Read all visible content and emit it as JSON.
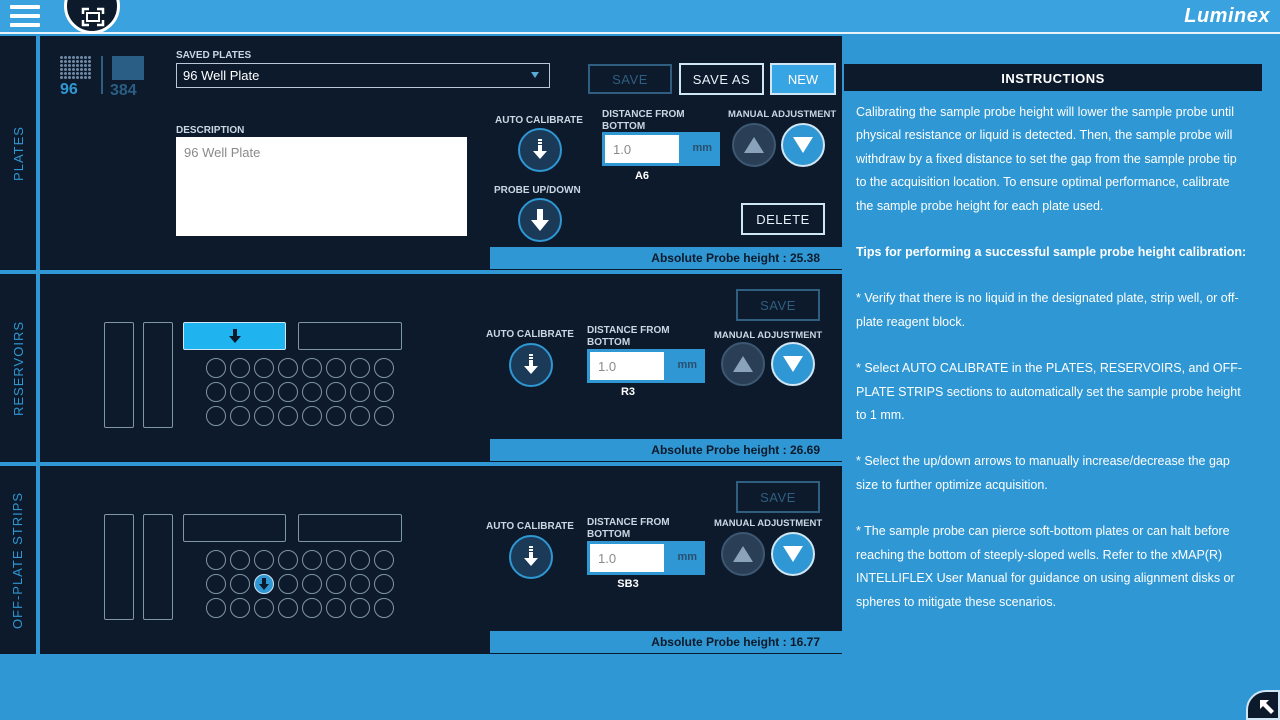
{
  "brand": "Luminex",
  "plates": {
    "tab": "PLATES",
    "thumb_96": "96",
    "thumb_384": "384",
    "saved_label": "SAVED PLATES",
    "saved_value": "96 Well Plate",
    "description_label": "DESCRIPTION",
    "description_value": "96 Well Plate",
    "save": "SAVE",
    "save_as": "SAVE AS",
    "new": "NEW",
    "auto_calibrate": "AUTO CALIBRATE",
    "probe_updown": "PROBE UP/DOWN",
    "distance_label": "DISTANCE FROM BOTTOM",
    "distance_value": "1.0",
    "unit": "mm",
    "well": "A6",
    "manual_adjustment": "MANUAL ADJUSTMENT",
    "delete": "DELETE",
    "abs_height": "Absolute Probe height :  25.38"
  },
  "reservoirs": {
    "tab": "RESERVOIRS",
    "save": "SAVE",
    "auto_calibrate": "AUTO CALIBRATE",
    "distance_label": "DISTANCE FROM BOTTOM",
    "distance_value": "1.0",
    "unit": "mm",
    "well": "R3",
    "manual_adjustment": "MANUAL ADJUSTMENT",
    "abs_height": "Absolute Probe height :  26.69"
  },
  "strips": {
    "tab": "OFF-PLATE STRIPS",
    "save": "SAVE",
    "auto_calibrate": "AUTO CALIBRATE",
    "distance_label": "DISTANCE FROM BOTTOM",
    "distance_value": "1.0",
    "unit": "mm",
    "well": "SB3",
    "manual_adjustment": "MANUAL ADJUSTMENT",
    "abs_height": "Absolute Probe height :  16.77"
  },
  "instructions": {
    "title": "INSTRUCTIONS",
    "p1": "Calibrating the sample probe height will lower the sample probe until physical resistance or liquid is detected. Then, the sample probe will withdraw by a fixed distance to set the gap from the sample probe tip to the acquisition location. To ensure optimal performance, calibrate the sample probe height for each plate used.",
    "tips_title": "Tips for performing a successful sample probe height calibration:",
    "tip1": "* Verify that there is no liquid in the designated plate, strip well, or off-plate reagent block.",
    "tip2": "* Select AUTO CALIBRATE in the PLATES, RESERVOIRS, and OFF-PLATE STRIPS sections to automatically set the sample probe height to 1 mm.",
    "tip3": "* Select the up/down arrows to manually increase/decrease the gap size to further optimize acquisition.",
    "tip4": "* The sample probe can pierce soft-bottom plates or can halt before reaching the bottom of steeply-sloped wells. Refer to the xMAP(R) INTELLIFLEX User Manual for guidance on using alignment disks or spheres to mitigate these scenarios."
  },
  "colors": {
    "accent": "#2f97d3",
    "panel": "#0d1a2b",
    "active": "#1fb3f0"
  }
}
